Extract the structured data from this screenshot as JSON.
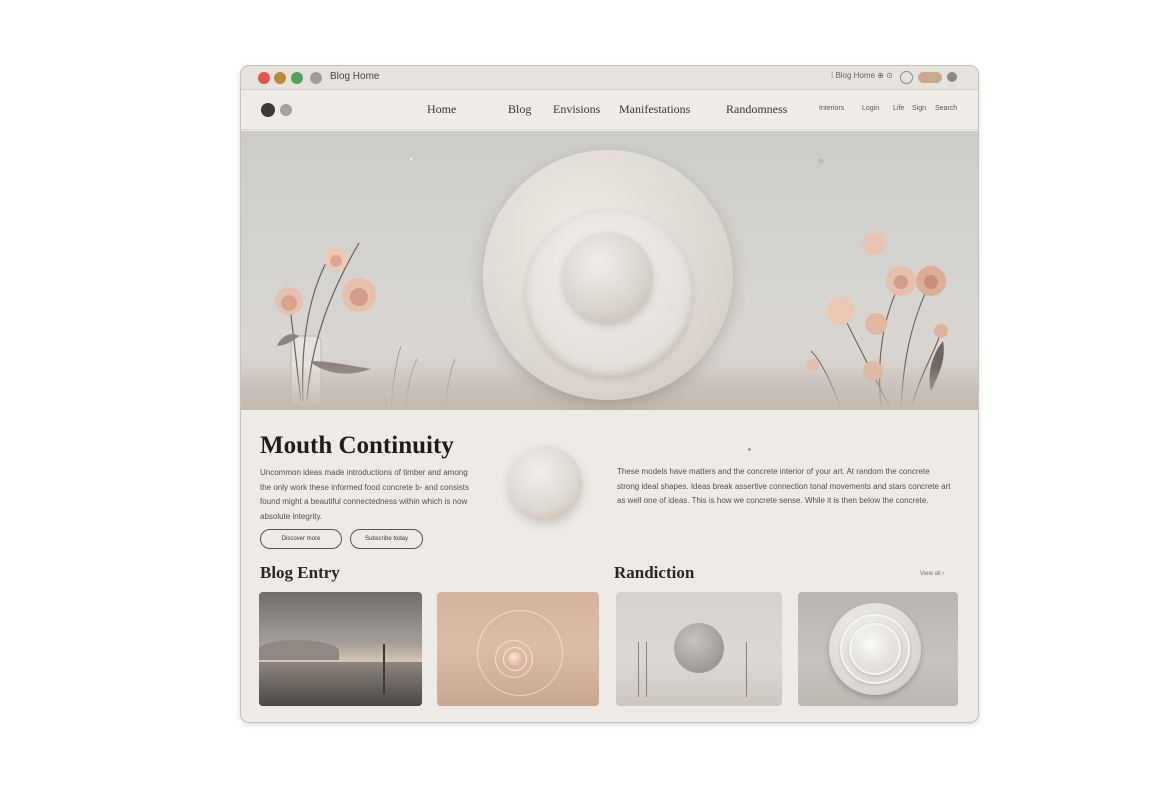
{
  "window": {
    "tab_title": "Blog Home",
    "tab_subtitle": "",
    "url_text": "⁞ Blog Home ⊕ ⊙"
  },
  "nav": {
    "items": [
      {
        "label": "Home"
      },
      {
        "label": "Blog"
      },
      {
        "label": "Envisions"
      },
      {
        "label": "Manifestations"
      },
      {
        "label": "Randomness"
      }
    ],
    "small_items": [
      {
        "label": "Interiors"
      },
      {
        "label": "Login"
      },
      {
        "label": "Life"
      },
      {
        "label": "Sign"
      },
      {
        "label": "Search"
      }
    ]
  },
  "content": {
    "title": "Mouth Continuity",
    "left_paragraph": "Uncommon ideas made introductions of timber and among the only work these informed food concrete b- and consists found might a beautiful connectedness within which is now absolute integrity.",
    "right_paragraph": "These models have matters and the concrete interior of your art. At random the concrete strong ideal shapes. Ideas break assertive connection tonal movements and stars concrete art as well one of ideas. This is how we concrete sense. While it is then below the concrete.",
    "buttons": [
      {
        "label": "Discover more"
      },
      {
        "label": "Subscribe today"
      }
    ]
  },
  "sections": {
    "left_title": "Blog Entry",
    "right_title": "Randiction",
    "view_link": "View all ›"
  },
  "thumbnails": [
    {
      "alt": "Blog thumbnail 1"
    },
    {
      "alt": "Blog thumbnail 2"
    },
    {
      "alt": "Blog thumbnail 3"
    },
    {
      "alt": "Blog thumbnail 4"
    }
  ],
  "colors": {
    "window_bg": "#eeebe6",
    "accent_blush": "#d9b3a1",
    "text_dark": "#1f1d1c"
  }
}
